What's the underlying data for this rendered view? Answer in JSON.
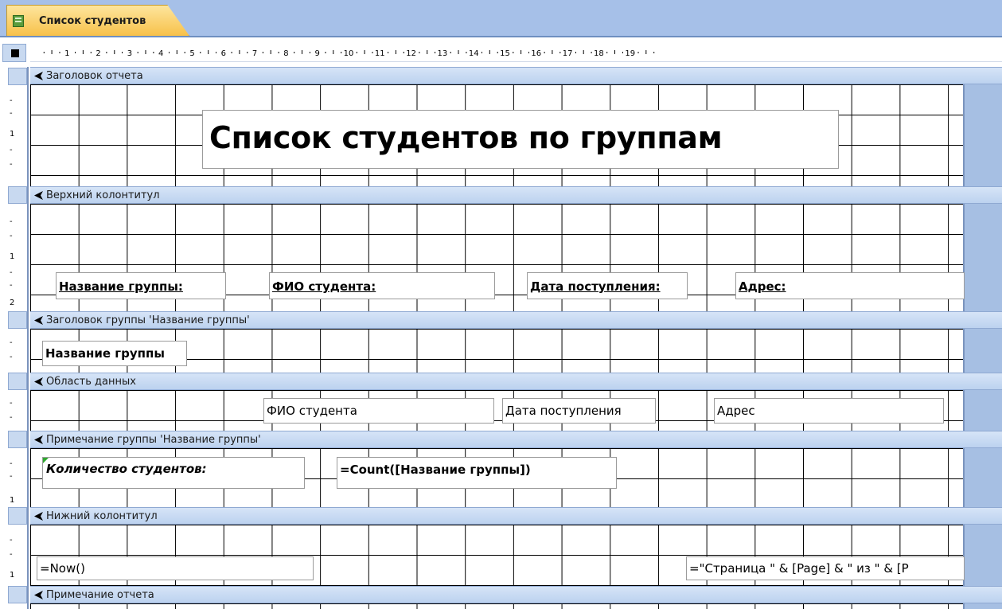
{
  "tab": {
    "title": "Список студентов",
    "icon": "report-icon"
  },
  "ruler": {
    "numbers": [
      "1",
      "2",
      "3",
      "4",
      "5",
      "6",
      "7",
      "8",
      "9",
      "10",
      "11",
      "12",
      "13",
      "14",
      "15",
      "16",
      "17",
      "18",
      "19"
    ],
    "vertical": [
      "1",
      "2",
      "1",
      "1"
    ]
  },
  "sections": {
    "report_header": "Заголовок отчета",
    "page_header": "Верхний колонтитул",
    "group_header": "Заголовок группы 'Название группы'",
    "detail": "Область данных",
    "group_footer": "Примечание группы 'Название группы'",
    "page_footer": "Нижний колонтитул",
    "report_footer": "Примечание отчета"
  },
  "controls": {
    "title": "Список студентов по группам",
    "lbl_group": "Название группы:",
    "lbl_fio": "ФИО студента:",
    "lbl_date": "Дата поступления:",
    "lbl_address": "Адрес:",
    "group_field": "Название группы",
    "fio_field": "ФИО студента",
    "date_field": "Дата поступления",
    "address_field": "Адрес",
    "count_label": "Количество студентов:",
    "count_expr": "=Count([Название группы])",
    "now_expr": "=Now()",
    "page_expr": "=\"Страница \" & [Page] & \" из \" & [Р"
  },
  "colors": {
    "tab_gold": "#f7c14a",
    "section_bar": "#c8d9f0",
    "side_strip": "#a6bfe3"
  }
}
